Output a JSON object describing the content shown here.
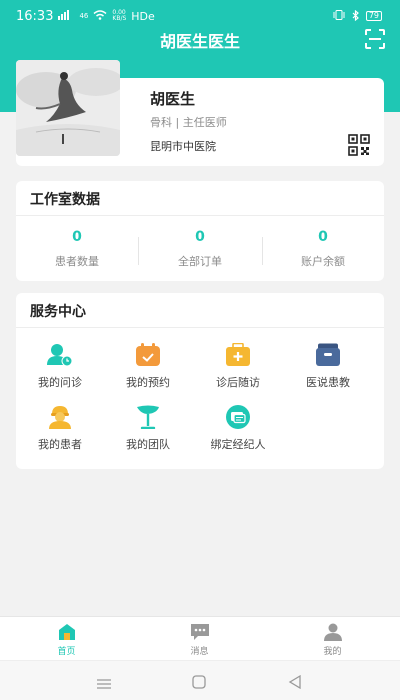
{
  "status_bar": {
    "time": "16:33",
    "signal": "46",
    "network_speed_top": "0.00",
    "network_speed_bottom": "KB/S",
    "hd_label": "HDe",
    "battery": "79"
  },
  "header": {
    "title": "胡医生医生"
  },
  "profile": {
    "name": "胡医生",
    "department": "骨科",
    "separator": "|",
    "position": "主任医师",
    "hospital": "昆明市中医院"
  },
  "studio": {
    "title": "工作室数据",
    "stats": [
      {
        "value": "0",
        "label": "患者数量"
      },
      {
        "value": "0",
        "label": "全部订单"
      },
      {
        "value": "0",
        "label": "账户余额"
      }
    ]
  },
  "service_center": {
    "title": "服务中心",
    "items": [
      {
        "label": "我的问诊",
        "icon": "consultation-icon",
        "color": "#1fc7b4"
      },
      {
        "label": "我的预约",
        "icon": "calendar-icon",
        "color": "#f39a3b"
      },
      {
        "label": "诊后随访",
        "icon": "medical-kit-icon",
        "color": "#f5b731"
      },
      {
        "label": "医说患教",
        "icon": "inbox-icon",
        "color": "#4a6a9c"
      },
      {
        "label": "我的患者",
        "icon": "patient-icon",
        "color": "#f5b731"
      },
      {
        "label": "我的团队",
        "icon": "team-flag-icon",
        "color": "#1fc7b4"
      },
      {
        "label": "绑定经纪人",
        "icon": "agent-card-icon",
        "color": "#1fc7b4"
      }
    ]
  },
  "tabbar": {
    "tabs": [
      {
        "label": "首页",
        "icon": "home-icon",
        "active": true
      },
      {
        "label": "消息",
        "icon": "message-icon",
        "active": false
      },
      {
        "label": "我的",
        "icon": "profile-icon",
        "active": false
      }
    ]
  },
  "colors": {
    "primary": "#1fc7b4",
    "background": "#f2f2f2"
  }
}
